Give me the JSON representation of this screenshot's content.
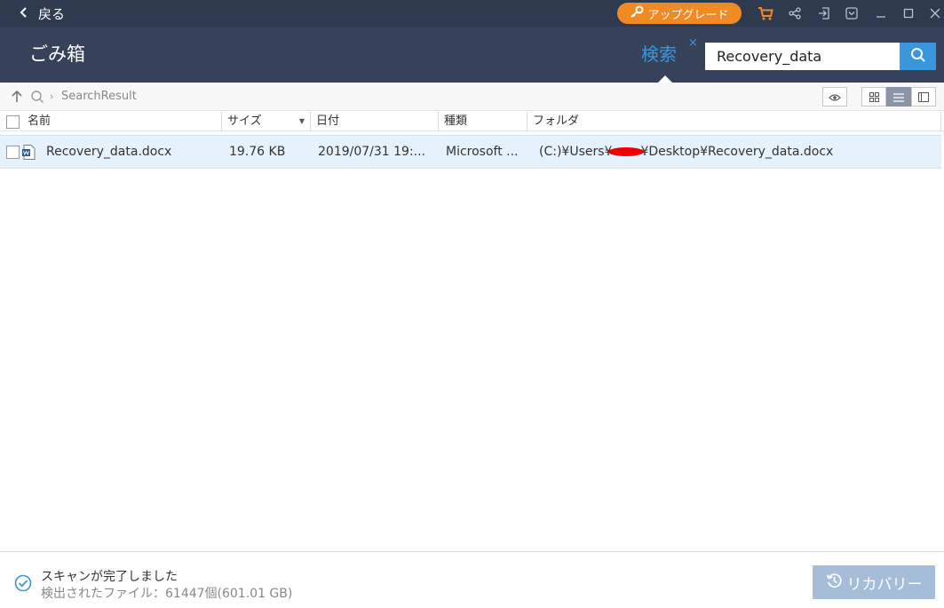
{
  "titlebar": {
    "back_label": "戻る",
    "upgrade_label": "アップグレード",
    "accent_color": "#f08a24",
    "icons": [
      "cart-icon",
      "share-icon",
      "signin-icon",
      "dropdown-menu-icon",
      "minimize-icon",
      "maximize-icon",
      "close-icon"
    ]
  },
  "header": {
    "title": "ごみ箱",
    "search_tab_label": "検索",
    "search_close": "×",
    "search_value": "Recovery_data",
    "accent_color": "#3a96dd"
  },
  "navbar": {
    "breadcrumb": "SearchResult"
  },
  "table": {
    "columns": [
      "名前",
      "サイズ",
      "日付",
      "種類",
      "フォルダ"
    ],
    "rows": [
      {
        "name": "Recovery_data.docx",
        "size": "19.76 KB",
        "date": "2019/07/31 19:...",
        "type": "Microsoft ...",
        "folder_prefix": "(C:)¥Users¥",
        "folder_suffix": "¥Desktop¥Recovery_data.docx"
      }
    ]
  },
  "footer": {
    "status_title": "スキャンが完了しました",
    "status_detail": "検出されたファイル：61447個(601.01 GB)",
    "recover_label": "リカバリー"
  }
}
